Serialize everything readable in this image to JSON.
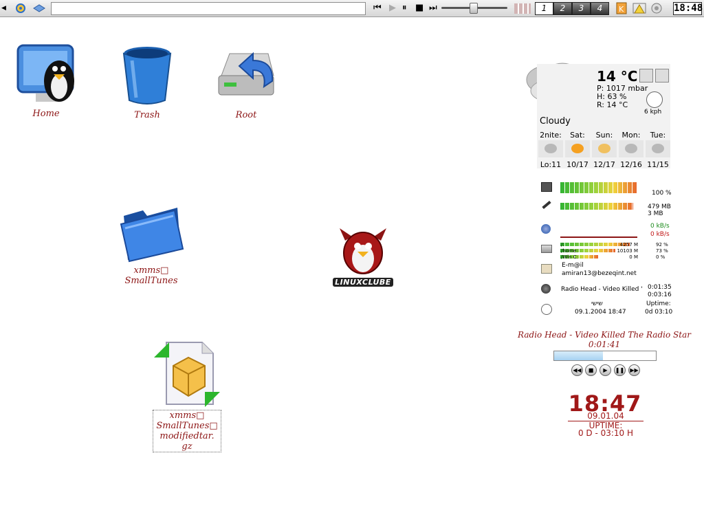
{
  "panel": {
    "virtual_desktops": [
      "1",
      "2",
      "3",
      "4"
    ],
    "active_desktop": 0,
    "clock": "18:48",
    "volume_level": 0.48
  },
  "desktop_icons": [
    {
      "label": "Home",
      "icon": "home-icon"
    },
    {
      "label": "Trash",
      "icon": "trash-icon"
    },
    {
      "label": "Root",
      "icon": "root-drive-icon"
    },
    {
      "label": "xmms□\nSmallTunes",
      "icon": "folder-icon"
    },
    {
      "label": "xmms□\nSmallTunes□\nmodifiedtar.\ngz",
      "icon": "archive-icon"
    }
  ],
  "logo_text": "LINUXCLUBE",
  "weather": {
    "temp": "14 °C",
    "pressure": "P: 1017 mbar",
    "humidity": "H: 63 %",
    "realfeel": "R: 14 °C",
    "wind": "6 kph",
    "condition": "Cloudy",
    "forecast": [
      {
        "day": "2nite:",
        "temp": "Lo:11",
        "icon": "rain-cloud-icon"
      },
      {
        "day": "Sat:",
        "temp": "10/17",
        "icon": "sun-icon"
      },
      {
        "day": "Sun:",
        "temp": "12/17",
        "icon": "partly-sunny-icon"
      },
      {
        "day": "Mon:",
        "temp": "12/16",
        "icon": "storm-cloud-icon"
      },
      {
        "day": "Tue:",
        "temp": "11/15",
        "icon": "cloud-icon"
      }
    ]
  },
  "sysmon": {
    "cpu": "100 %",
    "cpu_level": 1.0,
    "mem_used": "479 MB",
    "swap_used": "3 MB",
    "mem_level": 0.95,
    "net_in": "0 kB/s",
    "net_out": "0 kB/s",
    "disks": [
      {
        "label": "/:",
        "size": "4257 M",
        "pct": "92 %",
        "level": 0.92
      },
      {
        "label": "/home:",
        "size": "10103 M",
        "pct": "73 %",
        "level": 0.73
      },
      {
        "label": "/Win C:",
        "size": "0 M",
        "pct": "0 %",
        "level": 0.5
      }
    ],
    "mail_label": "E-m@il",
    "mail_addr": "amiran13@bezeqint.net",
    "song": "Radio Head - Video Killed '",
    "song_elapsed": "0:01:35",
    "song_total": "0:03:16",
    "date_header": "שישי",
    "date": "09.1.2004 18:47",
    "uptime_label": "Uptime:",
    "uptime": "0d 03:10"
  },
  "xmms": {
    "title": "Radio Head - Video Killed The Radio Star",
    "time": "0:01:41",
    "progress": 0.48
  },
  "clockwidget": {
    "time": "18:47",
    "date": "09.01.04",
    "uptime_label": "UPTIME:",
    "uptime": "0 D - 03:10 H"
  }
}
